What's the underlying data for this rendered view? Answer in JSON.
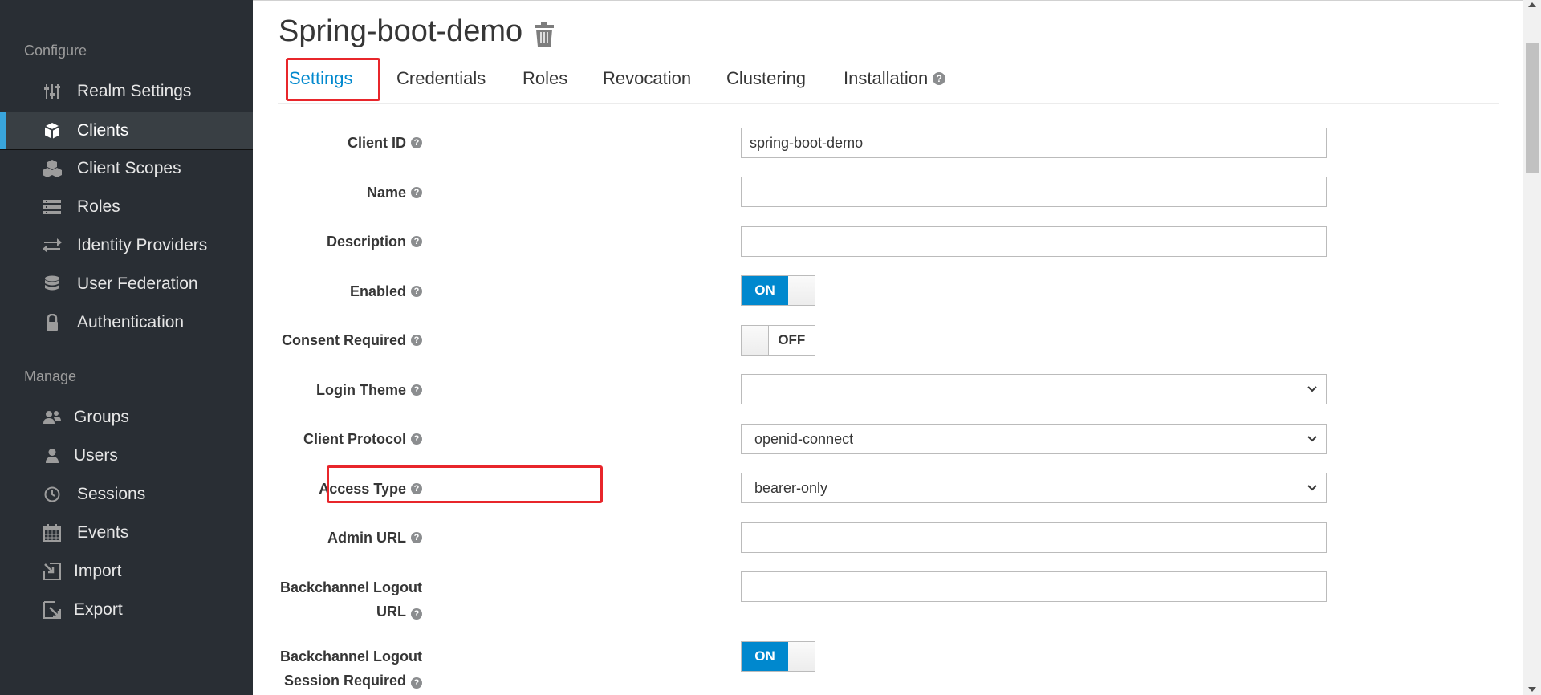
{
  "sidebar": {
    "configure_title": "Configure",
    "manage_title": "Manage",
    "configure_items": [
      {
        "label": "Realm Settings",
        "icon": "sliders-icon"
      },
      {
        "label": "Clients",
        "icon": "cube-icon",
        "active": true
      },
      {
        "label": "Client Scopes",
        "icon": "cubes-icon"
      },
      {
        "label": "Roles",
        "icon": "list-icon"
      },
      {
        "label": "Identity Providers",
        "icon": "exchange-icon"
      },
      {
        "label": "User Federation",
        "icon": "database-icon"
      },
      {
        "label": "Authentication",
        "icon": "lock-icon"
      }
    ],
    "manage_items": [
      {
        "label": "Groups",
        "icon": "users-icon"
      },
      {
        "label": "Users",
        "icon": "user-icon"
      },
      {
        "label": "Sessions",
        "icon": "clock-icon"
      },
      {
        "label": "Events",
        "icon": "calendar-icon"
      },
      {
        "label": "Import",
        "icon": "import-icon"
      },
      {
        "label": "Export",
        "icon": "export-icon"
      }
    ]
  },
  "header": {
    "title": "Spring-boot-demo"
  },
  "tabs": [
    {
      "label": "Settings",
      "active": true
    },
    {
      "label": "Credentials"
    },
    {
      "label": "Roles"
    },
    {
      "label": "Revocation"
    },
    {
      "label": "Clustering"
    },
    {
      "label": "Installation"
    }
  ],
  "form": {
    "client_id": {
      "label": "Client ID",
      "value": "spring-boot-demo"
    },
    "name": {
      "label": "Name",
      "value": ""
    },
    "description": {
      "label": "Description",
      "value": ""
    },
    "enabled": {
      "label": "Enabled",
      "state": "ON"
    },
    "consent_required": {
      "label": "Consent Required",
      "state": "OFF"
    },
    "login_theme": {
      "label": "Login Theme",
      "value": ""
    },
    "client_protocol": {
      "label": "Client Protocol",
      "value": "openid-connect"
    },
    "access_type": {
      "label": "Access Type",
      "value": "bearer-only"
    },
    "admin_url": {
      "label": "Admin URL",
      "value": ""
    },
    "backchannel_logout_url": {
      "label_line1": "Backchannel Logout",
      "label_line2": "URL",
      "value": ""
    },
    "backchannel_logout_session": {
      "label_line1": "Backchannel Logout",
      "label_line2": "Session Required",
      "state": "ON"
    }
  },
  "colors": {
    "accent": "#0088ce",
    "highlight_box": "#e8262b",
    "sidebar_bg": "#292e34",
    "active_bar": "#39a5dc"
  }
}
